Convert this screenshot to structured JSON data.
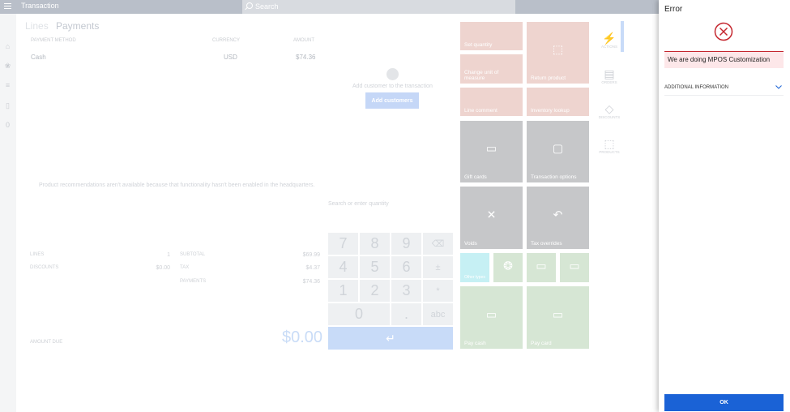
{
  "header": {
    "title": "Transaction",
    "search_placeholder": "Search"
  },
  "tabs": [
    {
      "label": "Lines"
    },
    {
      "label": "Payments"
    }
  ],
  "payments_table": {
    "columns": [
      "PAYMENT METHOD",
      "CURRENCY",
      "AMOUNT"
    ],
    "rows": [
      {
        "method": "Cash",
        "currency": "USD",
        "amount": "$74.36"
      }
    ]
  },
  "customer": {
    "prompt": "Add customer to the transaction",
    "add_label": "Add customers"
  },
  "recommendations": {
    "message": "Product recommendations aren't available because that functionality hasn't been enabled in the headquarters."
  },
  "quantity": {
    "placeholder": "Search or enter quantity"
  },
  "totals": {
    "lines_label": "LINES",
    "lines_value": "1",
    "discounts_label": "DISCOUNTS",
    "discounts_value": "$0.00",
    "subtotal_label": "SUBTOTAL",
    "subtotal_value": "$69.99",
    "tax_label": "TAX",
    "tax_value": "$4.37",
    "payments_label": "PAYMENTS",
    "payments_value": "$74.36",
    "amount_due_label": "AMOUNT DUE",
    "amount_due_value": "$0.00"
  },
  "numpad": {
    "keys": [
      "7",
      "8",
      "9",
      "⌫",
      "4",
      "5",
      "6",
      "±",
      "1",
      "2",
      "3",
      "*",
      "0",
      ".",
      "abc"
    ],
    "enter": "↵"
  },
  "tiles": {
    "set_quantity": "Set quantity",
    "change_uom": "Change unit of measure",
    "return_product": "Return product",
    "line_comment": "Line comment",
    "inventory_lookup": "Inventory lookup",
    "gift_cards": "Gift cards",
    "transaction_options": "Transaction options",
    "voids": "Voids",
    "tax_overrides": "Tax overrides",
    "cyan_tile": "Other types",
    "pay_cash": "Pay cash",
    "pay_card": "Pay card"
  },
  "side_actions": [
    {
      "label": "ACTIONS"
    },
    {
      "label": "ORDERS"
    },
    {
      "label": "DISCOUNTS"
    },
    {
      "label": "PRODUCTS"
    }
  ],
  "dialog": {
    "title": "Error",
    "message": "We are doing MPOS Customization",
    "additional_info": "ADDITIONAL INFORMATION",
    "ok_label": "OK",
    "accent_color": "#1a62d6",
    "error_color": "#c4262e"
  }
}
